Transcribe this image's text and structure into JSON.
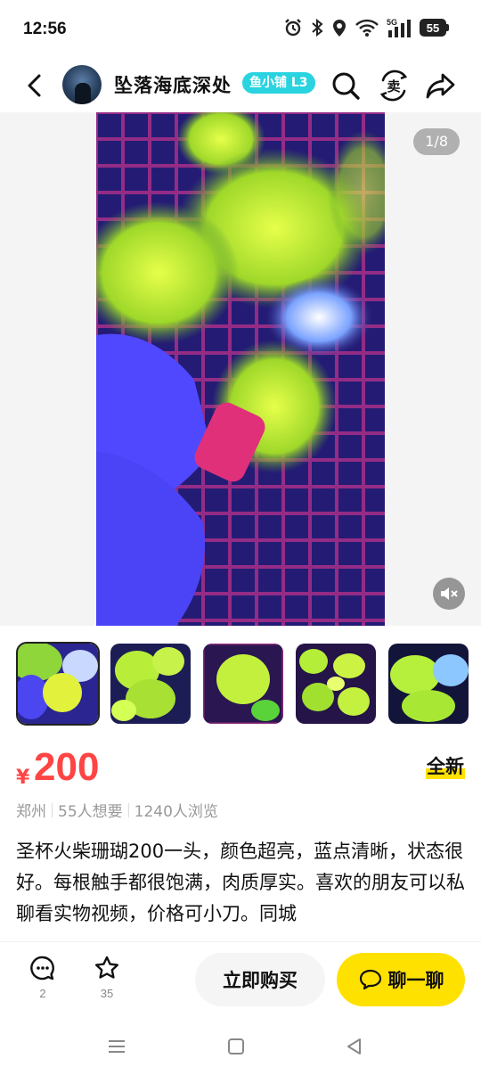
{
  "status_bar": {
    "time": "12:56",
    "network": "5G",
    "battery": "55"
  },
  "header": {
    "seller_name": "坠落海底深处",
    "badge": "鱼小铺 L3",
    "icons": [
      "back-arrow-icon",
      "search-icon",
      "sell-icon",
      "share-icon"
    ]
  },
  "gallery": {
    "counter": "1/8",
    "thumbnail_count": 5
  },
  "product": {
    "currency": "¥",
    "price": "200",
    "condition": "全新",
    "location": "郑州",
    "wants": "55人想要",
    "views": "1240人浏览",
    "description": "圣杯火柴珊瑚200一头，颜色超亮，蓝点清晰，状态很好。每根触手都很饱满，肉质厚实。喜欢的朋友可以私聊看实物视频，价格可小刀。同城"
  },
  "bottom_bar": {
    "comments_count": "2",
    "favorites_count": "35",
    "buy_label": "立即购买",
    "chat_label": "聊一聊"
  },
  "colors": {
    "price": "#ff4444",
    "accent": "#ffe100",
    "badge": "#2ad3e0"
  }
}
